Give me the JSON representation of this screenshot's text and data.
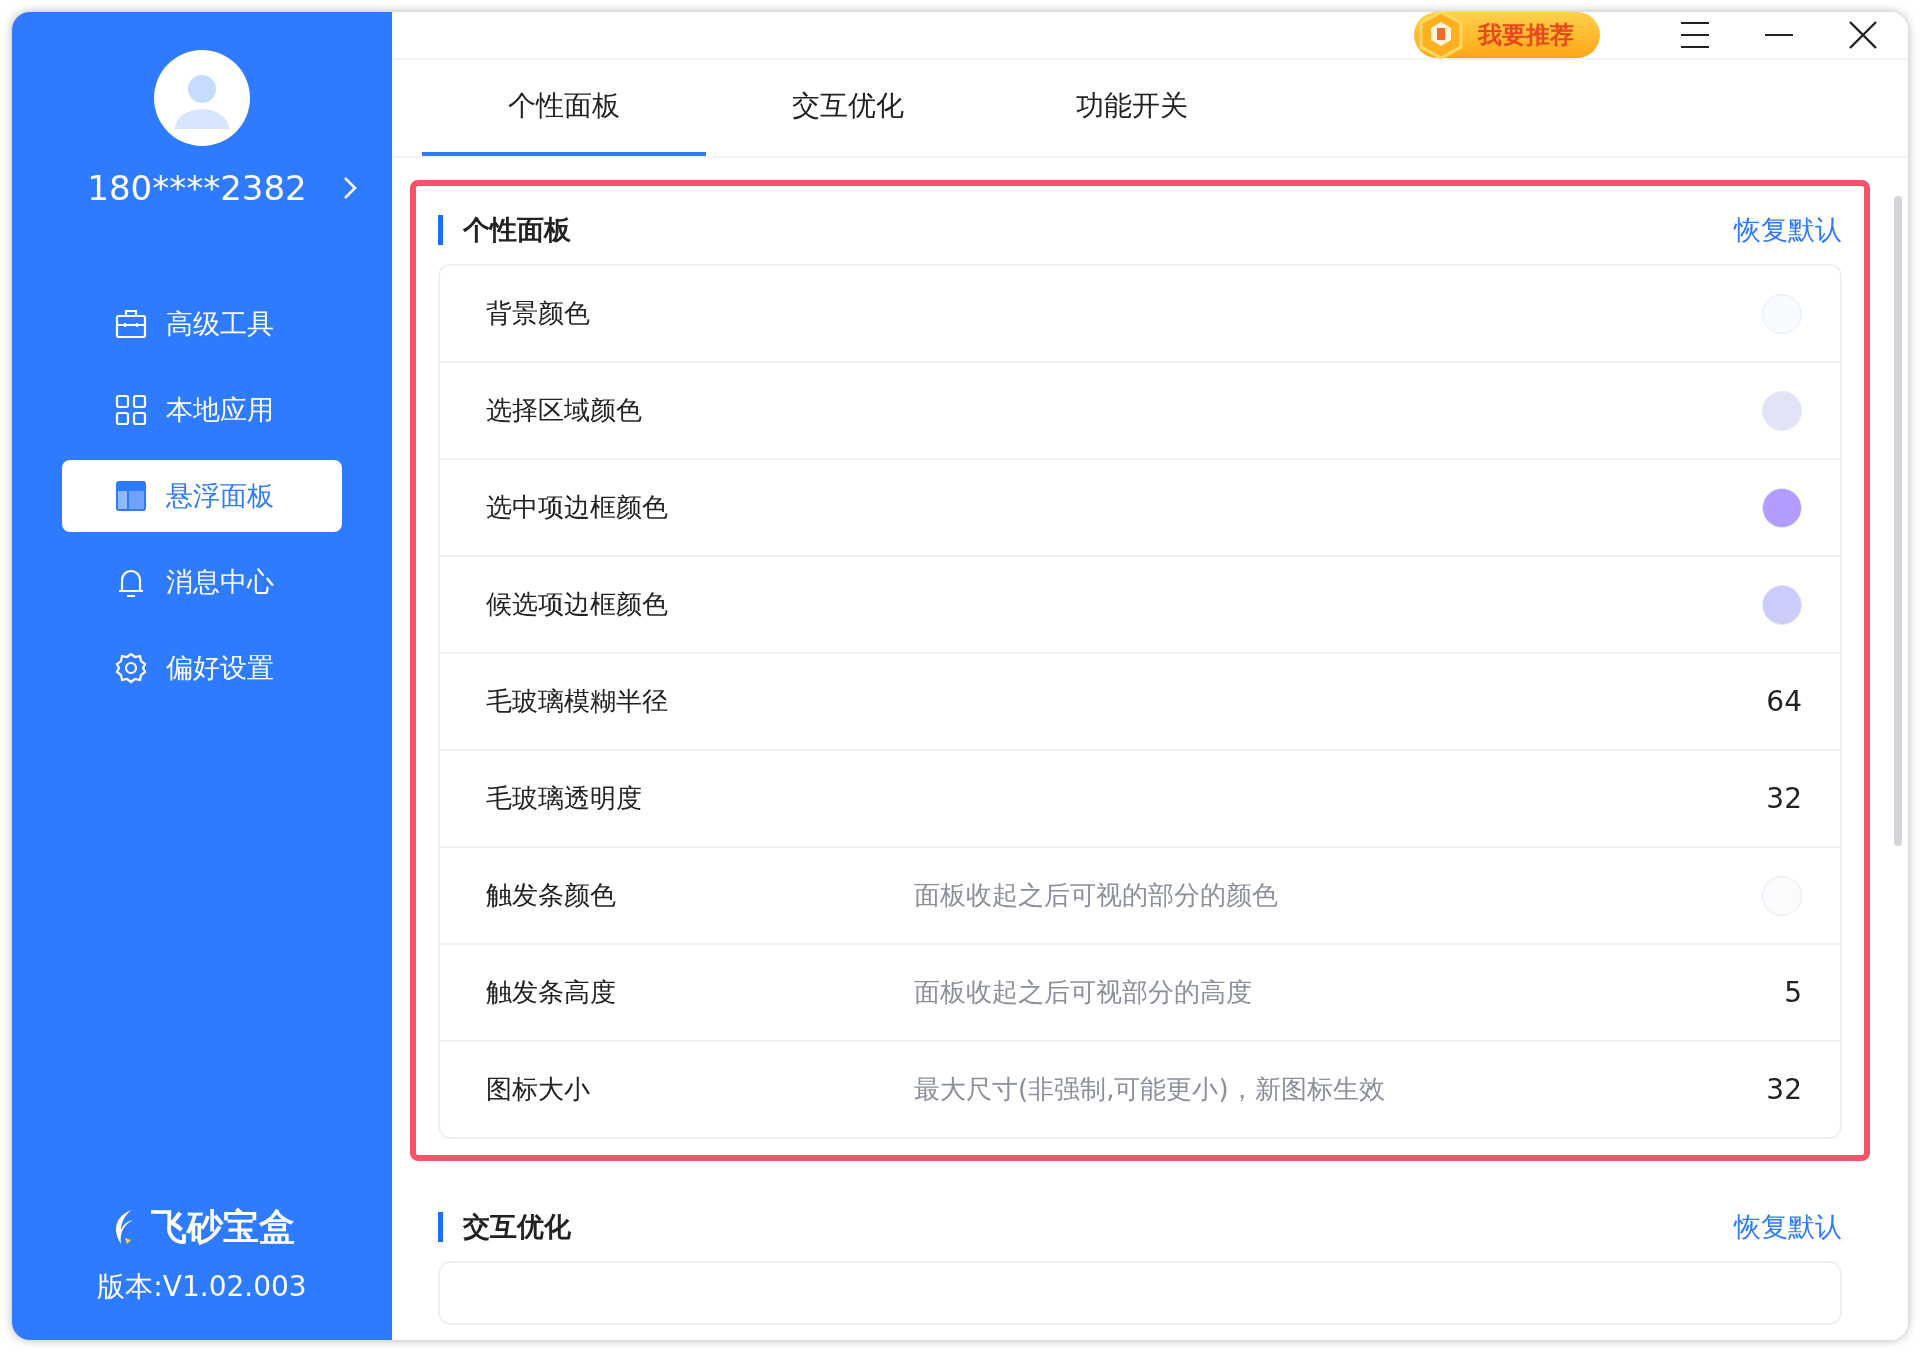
{
  "sidebar": {
    "account": "180****2382",
    "items": [
      {
        "label": "高级工具",
        "selected": false
      },
      {
        "label": "本地应用",
        "selected": false
      },
      {
        "label": "悬浮面板",
        "selected": true
      },
      {
        "label": "消息中心",
        "selected": false
      },
      {
        "label": "偏好设置",
        "selected": false
      }
    ],
    "brand": "飞砂宝盒",
    "version": "版本:V1.02.003"
  },
  "header": {
    "recommend_button": "我要推荐"
  },
  "tabs": [
    {
      "label": "个性面板",
      "selected": true
    },
    {
      "label": "交互优化",
      "selected": false
    },
    {
      "label": "功能开关",
      "selected": false
    }
  ],
  "sections": [
    {
      "title": "个性面板",
      "reset_link": "恢复默认",
      "highlighted": true,
      "rows": [
        {
          "kind": "color",
          "label": "背景颜色",
          "color": "#f7faff"
        },
        {
          "kind": "color",
          "label": "选择区域颜色",
          "color": "#e3e3f8"
        },
        {
          "kind": "color",
          "label": "选中项边框颜色",
          "color": "#b39cff"
        },
        {
          "kind": "color",
          "label": "候选项边框颜色",
          "color": "#cbcbfc"
        },
        {
          "kind": "value",
          "label": "毛玻璃模糊半径",
          "value": "64"
        },
        {
          "kind": "value",
          "label": "毛玻璃透明度",
          "value": "32"
        },
        {
          "kind": "color",
          "label": "触发条颜色",
          "description": "面板收起之后可视的部分的颜色",
          "color": "#f9fbfd"
        },
        {
          "kind": "value",
          "label": "触发条高度",
          "description": "面板收起之后可视部分的高度",
          "value": "5"
        },
        {
          "kind": "value",
          "label": "图标大小",
          "description": "最大尺寸(非强制,可能更小)，新图标生效",
          "value": "32"
        }
      ]
    },
    {
      "title": "交互优化",
      "reset_link": "恢复默认",
      "highlighted": false
    }
  ]
}
